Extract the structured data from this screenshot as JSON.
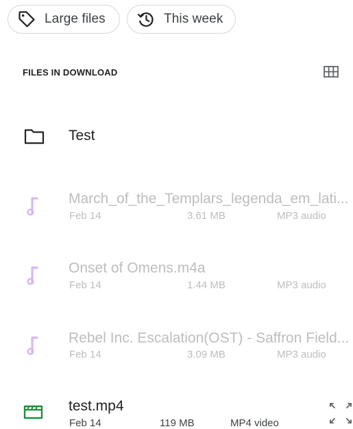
{
  "chips": {
    "large_files": {
      "label": "Large files",
      "icon": "tag-icon"
    },
    "this_week": {
      "label": "This week",
      "icon": "history-icon"
    }
  },
  "section": {
    "title": "FILES IN DOWNLOAD",
    "view_toggle_icon": "grid-view-icon"
  },
  "folder": {
    "name": "Test",
    "icon": "folder-icon"
  },
  "files": [
    {
      "name": "March_of_the_Templars_legenda_em_lati...",
      "date": "Feb 14",
      "size": "3.61 MB",
      "type": "MP3 audio",
      "icon": "audio-icon"
    },
    {
      "name": "Onset of Omens.m4a",
      "date": "Feb 14",
      "size": "1.44 MB",
      "type": "MP3 audio",
      "icon": "audio-icon"
    },
    {
      "name": "Rebel Inc. Escalation(OST) - Saffron Field...",
      "date": "Feb 14",
      "size": "3.09 MB",
      "type": "MP3 audio",
      "icon": "audio-icon"
    },
    {
      "name": "test.mp4",
      "date": "Feb 14",
      "size": "119 MB",
      "type": "MP4 video",
      "icon": "video-icon",
      "action_icon": "expand-icon"
    }
  ],
  "colors": {
    "audio_icon": "#d6b8f0",
    "video_icon": "#1e8e3e",
    "dim_text": "#bdbdbd",
    "chip_border": "#d7d7d7"
  }
}
